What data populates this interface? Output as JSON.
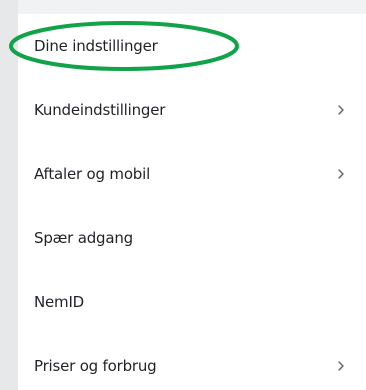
{
  "menu": {
    "items": [
      {
        "label": "Dine indstillinger",
        "has_chevron": false,
        "highlighted": true
      },
      {
        "label": "Kundeindstillinger",
        "has_chevron": true,
        "chevron": "›"
      },
      {
        "label": "Aftaler og mobil",
        "has_chevron": true,
        "chevron": "›"
      },
      {
        "label": "Spær adgang",
        "has_chevron": false
      },
      {
        "label": "NemID",
        "has_chevron": false
      },
      {
        "label": "Priser og forbrug",
        "has_chevron": true,
        "chevron": "›"
      }
    ]
  },
  "colors": {
    "text": "#1f2328",
    "gutter": "#e7e8e9",
    "topbar": "#f1f2f3",
    "highlight_ring": "#12a24a",
    "chevron": "#5b6066"
  }
}
